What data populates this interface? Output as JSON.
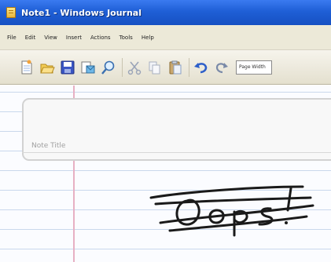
{
  "window": {
    "title": "Note1 - Windows Journal"
  },
  "menu": {
    "items": [
      "File",
      "Edit",
      "View",
      "Insert",
      "Actions",
      "Tools",
      "Help"
    ]
  },
  "toolbar": {
    "buttons": [
      {
        "icon": "new-note-icon"
      },
      {
        "icon": "open-folder-icon"
      },
      {
        "icon": "save-icon"
      },
      {
        "icon": "send-icon"
      },
      {
        "icon": "find-icon"
      },
      {
        "icon": "cut-icon"
      },
      {
        "icon": "copy-icon"
      },
      {
        "icon": "paste-icon"
      },
      {
        "icon": "undo-icon"
      },
      {
        "icon": "redo-icon"
      }
    ],
    "zoom_value": "Page Width"
  },
  "note": {
    "title_placeholder": "Note Title",
    "ink_text": "Oops!",
    "ink_color": "#1a1a1a",
    "margin_color": "#e7b0c4",
    "rule_color": "#c9d8ec"
  },
  "colors": {
    "titlebar": "#1f5fd6",
    "menubar": "#ece9d8"
  }
}
